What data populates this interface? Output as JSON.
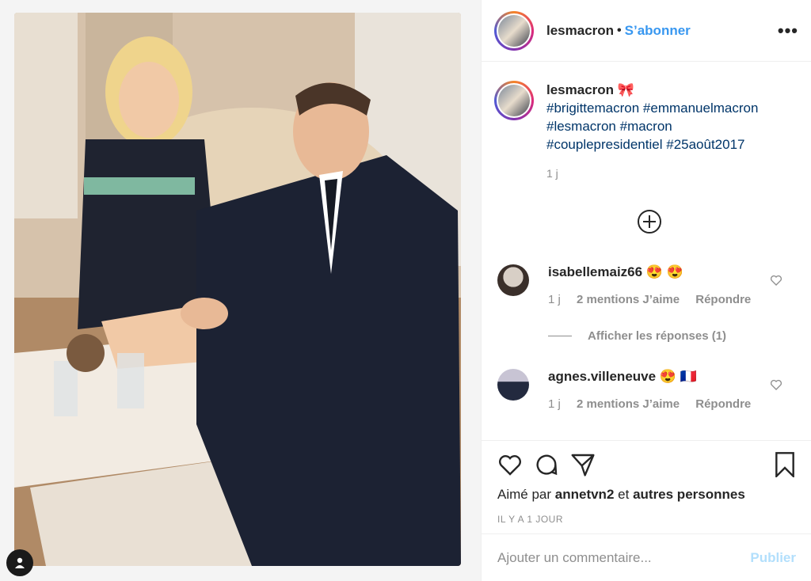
{
  "post": {
    "username": "lesmacron",
    "follow_label": "S’abonner",
    "more_label": "•••"
  },
  "caption": {
    "username": "lesmacron",
    "emoji": "🎀",
    "hashtags": [
      "#brigittemacron",
      "#emmanuelmacron",
      "#lesmacron",
      "#macron",
      "#couplepresidentiel",
      "#25août2017"
    ],
    "time": "1 j"
  },
  "comments": [
    {
      "username": "isabellemaiz66",
      "text": "😍 😍",
      "time": "1 j",
      "likes": "2 mentions J’aime",
      "reply": "Répondre"
    },
    {
      "username": "agnes.villeneuve",
      "text": "😍 🇫🇷",
      "time": "1 j",
      "likes": "2 mentions J’aime",
      "reply": "Répondre"
    }
  ],
  "view_replies": "Afficher les réponses (1)",
  "likes": {
    "prefix": "Aimé par",
    "user": "annetvn2",
    "conj": "et",
    "others": "autres personnes"
  },
  "timestamp": "IL Y A 1 JOUR",
  "add_comment": {
    "placeholder": "Ajouter un commentaire...",
    "publish": "Publier"
  }
}
